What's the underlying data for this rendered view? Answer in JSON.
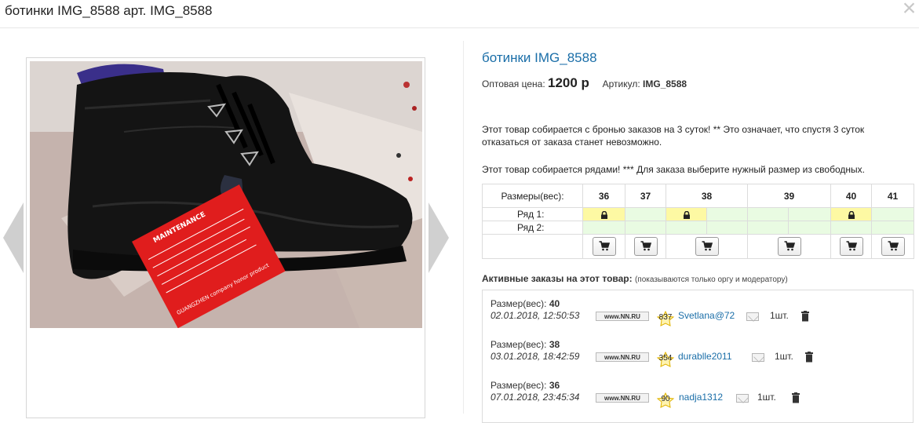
{
  "window": {
    "title": "ботинки IMG_8588 арт. IMG_8588",
    "close_label": "×"
  },
  "product": {
    "title": "ботинки IMG_8588",
    "price_label": "Оптовая цена:",
    "price": "1200 р",
    "article_label": "Артикул:",
    "article": "IMG_8588"
  },
  "notices": [
    "Этот товар собирается с бронью заказов на 3 суток! ** Это означает, что спустя 3 суток отказаться от заказа станет невозможно.",
    "Этот товар собирается рядами! *** Для заказа выберите нужный размер из свободных."
  ],
  "sizes": {
    "header_label": "Размеры(вес):",
    "columns": [
      "36",
      "37",
      "38",
      "39",
      "40",
      "41"
    ],
    "rows": [
      {
        "label": "Ряд 1:",
        "booked": [
          true,
          false,
          true,
          false,
          false,
          false,
          true,
          false
        ]
      },
      {
        "label": "Ряд 2:",
        "booked": [
          false,
          false,
          false,
          false,
          false,
          false,
          false,
          false
        ]
      }
    ]
  },
  "photo": {
    "tag_text": "MAINTENANCE",
    "tag_brand": "GUANGZHEN company honor product"
  },
  "orders": {
    "title": "Активные заказы на этот товар:",
    "note": "(показываются только оргу и модератору)",
    "size_label": "Размер(вес):",
    "site_badge": "www.NN.RU",
    "items": [
      {
        "size": "40",
        "date": "02.01.2018, 12:50:53",
        "rating": "837",
        "user": "Svetlana@72",
        "qty": "1шт."
      },
      {
        "size": "38",
        "date": "03.01.2018, 18:42:59",
        "rating": "354",
        "user": "durablle2011",
        "qty": "1шт."
      },
      {
        "size": "36",
        "date": "07.01.2018, 23:45:34",
        "rating": "90",
        "user": "nadja1312",
        "qty": "1шт."
      }
    ]
  },
  "icons": {
    "close": "close-icon",
    "prev": "arrow-left-icon",
    "next": "arrow-right-icon",
    "lock": "lock-icon",
    "cart": "cart-icon",
    "mail": "mail-icon",
    "trash": "trash-icon",
    "star": "star-icon"
  },
  "colors": {
    "link": "#1a6ea8",
    "free_cell": "#e9fbe2",
    "booked_cell": "#fdf9a3"
  }
}
